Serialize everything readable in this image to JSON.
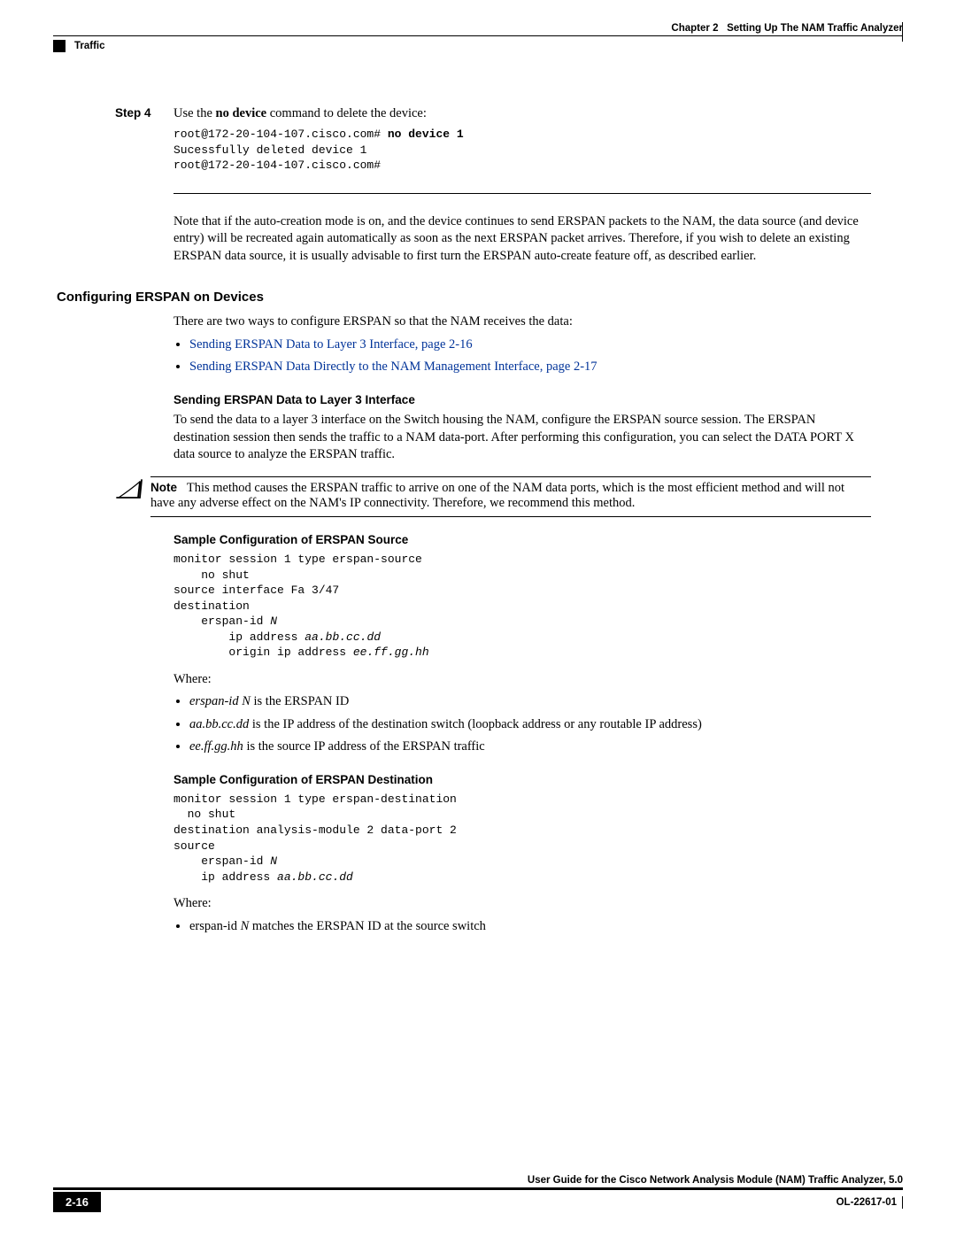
{
  "header": {
    "chapter_label": "Chapter 2",
    "chapter_title": "Setting Up The NAM Traffic Analyzer",
    "section": "Traffic"
  },
  "step4": {
    "label": "Step 4",
    "text_pre": "Use the ",
    "bold": "no device",
    "text_post": " command to delete the device:",
    "cli_prompt1": "root@172-20-104-107.cisco.com# ",
    "cli_cmd": "no device 1",
    "cli_line2": "Sucessfully deleted device 1",
    "cli_line3": "root@172-20-104-107.cisco.com#"
  },
  "note_para": "Note that if the auto-creation mode is on, and the device continues to send ERSPAN packets to the NAM, the data source (and device entry) will be recreated again automatically as soon as the next ERSPAN packet arrives. Therefore, if you wish to delete an existing ERSPAN data source, it is usually advisable to first turn the ERSPAN auto-create feature off, as described earlier.",
  "configuring": {
    "heading": "Configuring ERSPAN on Devices",
    "intro": "There are two ways to configure ERSPAN so that the NAM receives the data:",
    "link1": "Sending ERSPAN Data to Layer 3 Interface, page 2-16",
    "link2": "Sending ERSPAN Data Directly to the NAM Management Interface, page 2-17"
  },
  "layer3": {
    "heading": "Sending ERSPAN Data to Layer 3 Interface",
    "para": "To send the data to a layer 3 interface on the Switch housing the NAM, configure the ERSPAN source session. The ERSPAN destination session then sends the traffic to a NAM data-port. After performing this configuration, you can select the DATA PORT X data source to analyze the ERSPAN traffic."
  },
  "note": {
    "label": "Note",
    "text": "This method causes the ERSPAN traffic to arrive on one of the NAM data ports, which is the most efficient method and will not have any adverse effect on the NAM's IP connectivity. Therefore, we recommend this method."
  },
  "sample_source": {
    "heading": "Sample Configuration of ERSPAN Source",
    "l1": "monitor session 1 type erspan-source",
    "l2": "    no shut",
    "l3": "source interface Fa 3/47",
    "l4": "destination",
    "l5a": "    erspan-id ",
    "l5b": "N",
    "l6a": "        ip address ",
    "l6b": "aa.bb.cc.dd",
    "l7a": "        origin ip address ",
    "l7b": "ee.ff.gg.hh",
    "where": "Where:",
    "b1a": "erspan-id N",
    "b1b": " is the ERSPAN ID",
    "b2a": "aa.bb.cc.dd",
    "b2b": " is the IP address of the destination switch (loopback address or any routable IP address)",
    "b3a": "ee.ff.gg.hh",
    "b3b": " is the source IP address of the ERSPAN traffic"
  },
  "sample_dest": {
    "heading": "Sample Configuration of ERSPAN Destination",
    "l1": "monitor session 1 type erspan-destination",
    "l2": "  no shut",
    "l3": "destination analysis-module 2 data-port 2",
    "l4": "source",
    "l5a": "    erspan-id ",
    "l5b": "N",
    "l6a": "    ip address ",
    "l6b": "aa.bb.cc.dd",
    "where": "Where:",
    "b1a": "erspan-id ",
    "b1b": "N",
    "b1c": " matches the ERSPAN ID at the source switch"
  },
  "footer": {
    "title": "User Guide for the Cisco Network Analysis Module (NAM) Traffic Analyzer, 5.0",
    "page_num": "2-16",
    "doc_id": "OL-22617-01"
  }
}
